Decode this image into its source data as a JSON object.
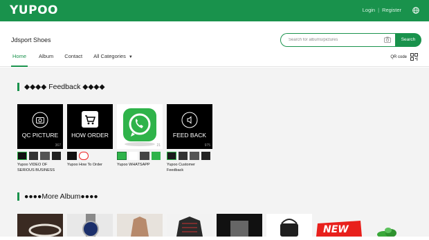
{
  "topbar": {
    "logo_left": "YU",
    "logo_mid": "P",
    "logo_right": "OO",
    "login": "Login",
    "separator": "|",
    "register": "Register",
    "language_icon": "globe-icon"
  },
  "header": {
    "store_name": "Jdsport Shoes",
    "search_placeholder": "Search for albums/pictures",
    "search_button": "Search",
    "qr_label": "QR code"
  },
  "nav": {
    "items": [
      "Home",
      "Album",
      "Contact",
      "All Categories"
    ],
    "active": "Home"
  },
  "feedback_section": {
    "title": "◆◆◆◆ Feedback ◆◆◆◆",
    "albums": [
      {
        "label": "QC PICTURE",
        "count": "367",
        "title": "Yupoo VIDEO OF SERIOUS BUSINESS"
      },
      {
        "label": "HOW ORDER",
        "count": "",
        "title": "Yupoo How To Order"
      },
      {
        "label": "",
        "count": "21",
        "title": "Yupoo WHATSAPP"
      },
      {
        "label": "FEED BACK",
        "count": "975",
        "title": "Yupoo Customer Feedback"
      }
    ]
  },
  "more_section": {
    "title": "●●●●More Album●●●●",
    "badge": "NEW"
  },
  "colors": {
    "brand": "#19924c",
    "whatsapp": "#2fb34a"
  }
}
